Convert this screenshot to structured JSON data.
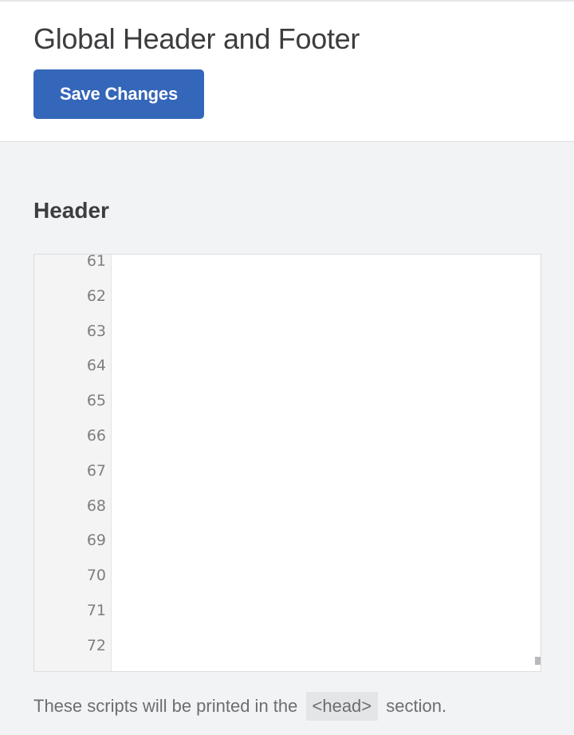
{
  "page": {
    "title": "Global Header and Footer",
    "save_label": "Save Changes"
  },
  "header_section": {
    "title": "Header",
    "editor": {
      "line_numbers": [
        "61",
        "62",
        "63",
        "64",
        "65",
        "66",
        "67",
        "68",
        "69",
        "70",
        "71",
        "72"
      ],
      "content": ""
    },
    "help": {
      "before": "These scripts will be printed in the",
      "code": "<head>",
      "after": "section."
    }
  },
  "colors": {
    "accent": "#3466b9",
    "background": "#f2f3f5"
  }
}
